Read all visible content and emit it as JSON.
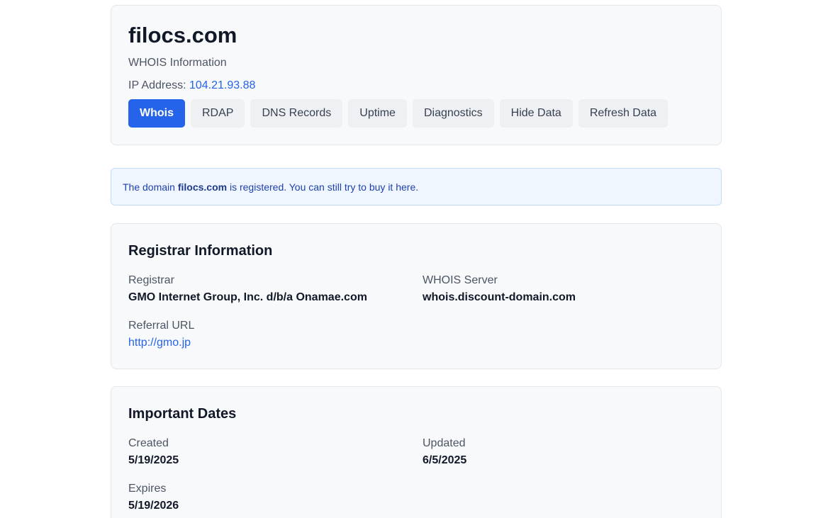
{
  "header": {
    "domain": "filocs.com",
    "subtitle": "WHOIS Information",
    "ip_label": "IP Address:",
    "ip_value": "104.21.93.88"
  },
  "tabs": [
    {
      "label": "Whois",
      "active": true
    },
    {
      "label": "RDAP",
      "active": false
    },
    {
      "label": "DNS Records",
      "active": false
    },
    {
      "label": "Uptime",
      "active": false
    },
    {
      "label": "Diagnostics",
      "active": false
    },
    {
      "label": "Hide Data",
      "active": false
    },
    {
      "label": "Refresh Data",
      "active": false
    }
  ],
  "notice": {
    "prefix": "The domain",
    "domain": "filocs.com",
    "middle": "is registered. You can still try to",
    "link": "buy it here."
  },
  "registrar": {
    "title": "Registrar Information",
    "registrar_label": "Registrar",
    "registrar_value": "GMO Internet Group, Inc. d/b/a Onamae.com",
    "whois_server_label": "WHOIS Server",
    "whois_server_value": "whois.discount-domain.com",
    "referral_label": "Referral URL",
    "referral_value": "http://gmo.jp"
  },
  "dates": {
    "title": "Important Dates",
    "created_label": "Created",
    "created_value": "5/19/2025",
    "updated_label": "Updated",
    "updated_value": "6/5/2025",
    "expires_label": "Expires",
    "expires_value": "5/19/2026"
  },
  "colors": {
    "accent": "#2563eb",
    "notice_bg": "#eff6ff",
    "card_bg": "#f8f9fb"
  }
}
